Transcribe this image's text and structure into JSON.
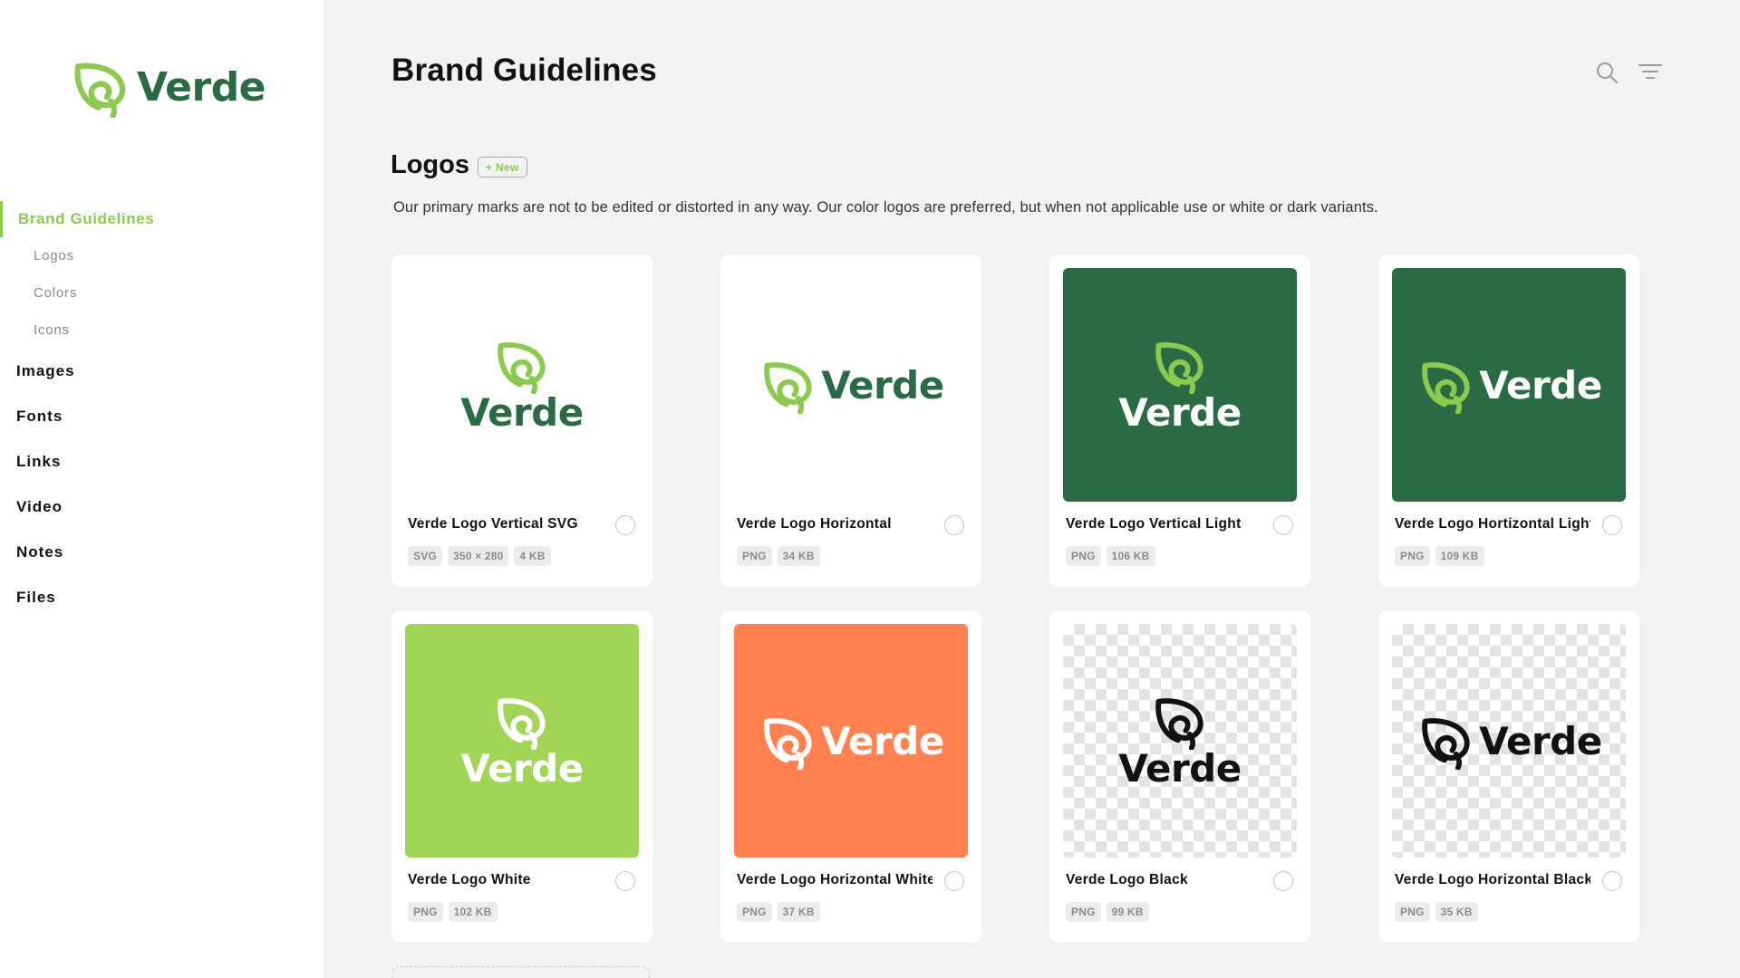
{
  "brand": {
    "name": "Verde"
  },
  "sidebar": {
    "active": "Brand Guidelines",
    "sub_items": [
      "Logos",
      "Colors",
      "Icons"
    ],
    "items": [
      "Images",
      "Fonts",
      "Links",
      "Video",
      "Notes",
      "Files"
    ]
  },
  "header": {
    "title": "Brand Guidelines",
    "search_icon": "search-icon",
    "filter_icon": "filter-icon"
  },
  "section": {
    "title": "Logos",
    "badge": "+ New",
    "description": "Our primary marks are not to be edited or distorted in any way. Our color logos are preferred, but when not applicable use or white or dark variants."
  },
  "colors": {
    "brand_dark": "#2a6b45",
    "brand_light": "#8cc94f",
    "lime": "#a2d456",
    "orange": "#ff814f",
    "black": "#111111",
    "white": "#ffffff"
  },
  "cards": [
    {
      "name": "Verde Logo Vertical SVG",
      "tags": [
        "SVG",
        "350 × 280",
        "4 KB"
      ]
    },
    {
      "name": "Verde Logo Horizontal",
      "tags": [
        "PNG",
        "34 KB"
      ]
    },
    {
      "name": "Verde Logo Vertical Light",
      "tags": [
        "PNG",
        "106 KB"
      ]
    },
    {
      "name": "Verde Logo Hortizontal Light",
      "tags": [
        "PNG",
        "109 KB"
      ]
    },
    {
      "name": "Verde Logo White",
      "tags": [
        "PNG",
        "102 KB"
      ]
    },
    {
      "name": "Verde Logo Horizontal White",
      "tags": [
        "PNG",
        "37 KB"
      ]
    },
    {
      "name": "Verde Logo Black",
      "tags": [
        "PNG",
        "99 KB"
      ]
    },
    {
      "name": "Verde Logo Horizontal Black",
      "tags": [
        "PNG",
        "35 KB"
      ]
    }
  ]
}
